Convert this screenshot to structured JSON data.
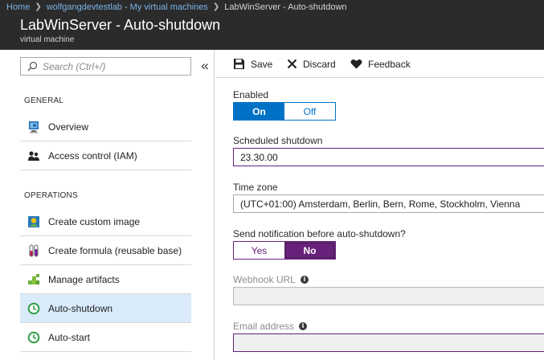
{
  "breadcrumb": {
    "items": [
      "Home",
      "wolfgangdevtestlab - My virtual machines"
    ],
    "current": "LabWinServer - Auto-shutdown"
  },
  "header": {
    "title": "LabWinServer - Auto-shutdown",
    "subtitle": "virtual machine"
  },
  "sidebar": {
    "search_placeholder": "Search (Ctrl+/)",
    "collapse_glyph": "«",
    "sections": [
      {
        "label": "GENERAL",
        "items": [
          {
            "label": "Overview",
            "icon": "overview-icon"
          },
          {
            "label": "Access control (IAM)",
            "icon": "access-control-icon"
          }
        ]
      },
      {
        "label": "OPERATIONS",
        "items": [
          {
            "label": "Create custom image",
            "icon": "custom-image-icon"
          },
          {
            "label": "Create formula (reusable base)",
            "icon": "formula-icon"
          },
          {
            "label": "Manage artifacts",
            "icon": "artifacts-icon"
          },
          {
            "label": "Auto-shutdown",
            "icon": "clock-icon",
            "active": true
          },
          {
            "label": "Auto-start",
            "icon": "clock-icon"
          }
        ]
      }
    ]
  },
  "toolbar": {
    "save_label": "Save",
    "discard_label": "Discard",
    "feedback_label": "Feedback"
  },
  "form": {
    "enabled": {
      "label": "Enabled",
      "on": "On",
      "off": "Off",
      "selected": "On"
    },
    "scheduled_shutdown": {
      "label": "Scheduled shutdown",
      "value": "23.30.00"
    },
    "time_zone": {
      "label": "Time zone",
      "value": "(UTC+01:00) Amsterdam, Berlin, Bern, Rome, Stockholm, Vienna"
    },
    "notification": {
      "label": "Send notification before auto-shutdown?",
      "yes": "Yes",
      "no": "No",
      "selected": "No"
    },
    "webhook": {
      "label": "Webhook URL",
      "value": ""
    },
    "email": {
      "label": "Email address",
      "value": ""
    }
  },
  "colors": {
    "header_bg": "#2b2b2b",
    "link": "#7ab4e6",
    "accent_blue": "#0072c6",
    "accent_purple": "#68217a",
    "active_nav_bg": "#d9ebfa"
  }
}
